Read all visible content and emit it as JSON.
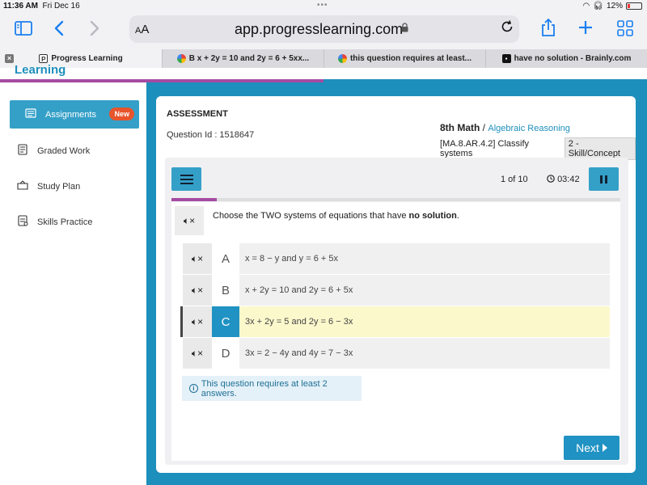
{
  "status_bar": {
    "time": "11:36 AM",
    "date": "Fri Dec 16",
    "battery": "12%"
  },
  "browser": {
    "text_size_label": "AA",
    "url": "app.progresslearning.com",
    "icons": {
      "sidebar": "sidebar-icon",
      "back": "chevron-left-icon",
      "forward": "chevron-right-icon",
      "lock": "lock-icon",
      "reload": "reload-icon",
      "share": "share-icon",
      "new_tab": "plus-icon",
      "tabs_overview": "grid-icon"
    },
    "tabs": [
      {
        "label": "Progress Learning",
        "favicon": "P",
        "active": true
      },
      {
        "label": "B x + 2y = 10 and 2y = 6 + 5xx...",
        "favicon": "G",
        "active": false
      },
      {
        "label": "this question requires at least...",
        "favicon": "G",
        "active": false
      },
      {
        "label": "have no solution - Brainly.com",
        "favicon": "B",
        "active": false
      }
    ]
  },
  "app": {
    "logo_text": "Learning",
    "accent_color": "#1d8fbc",
    "sidebar": {
      "items": [
        {
          "label": "Assignments",
          "icon": "assignments-icon",
          "badge": "New",
          "active": true
        },
        {
          "label": "Graded Work",
          "icon": "graded-work-icon",
          "active": false
        },
        {
          "label": "Study Plan",
          "icon": "study-plan-icon",
          "active": false
        },
        {
          "label": "Skills Practice",
          "icon": "skills-practice-icon",
          "active": false
        }
      ]
    },
    "assessment": {
      "title": "ASSESSMENT",
      "question_id": "Question Id : 1518647",
      "subject": "8th Math",
      "separator": " / ",
      "topic": "Algebraic Reasoning",
      "standard": "[MA.8.AR.4.2] Classify systems",
      "dok": "2 - Skill/Concept"
    },
    "question_panel": {
      "counter": "1 of 10",
      "timer": "03:42",
      "progress_fraction": 0.1,
      "prompt_prefix": "Choose the TWO systems of equations that have ",
      "prompt_bold": "no solution",
      "prompt_suffix": ".",
      "options": [
        {
          "letter": "A",
          "text": "x = 8 − y and y = 6 + 5x",
          "selected": false
        },
        {
          "letter": "B",
          "text": "x + 2y = 10 and 2y = 6 + 5x",
          "selected": false
        },
        {
          "letter": "C",
          "text": "3x + 2y = 5 and 2y = 6 − 3x",
          "selected": true
        },
        {
          "letter": "D",
          "text": "3x = 2 − 4y and 4y = 7 − 3x",
          "selected": false
        }
      ],
      "info_message": "This question requires at least 2 answers.",
      "next_label": "Next"
    }
  }
}
